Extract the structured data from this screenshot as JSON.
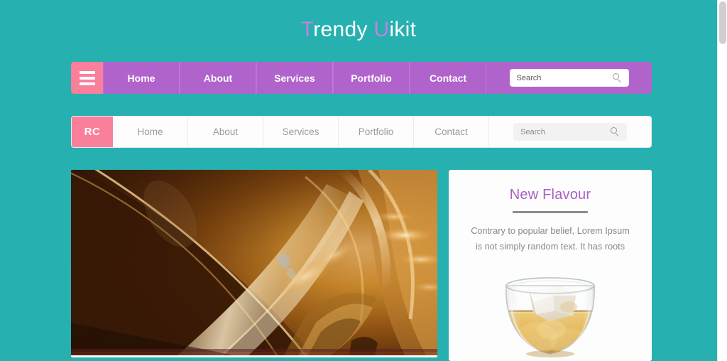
{
  "site": {
    "title_accent_1": "T",
    "title_part_1": "rendy ",
    "title_accent_2": "U",
    "title_part_2": "ikit"
  },
  "navbar_purple": {
    "brand_icon": "hamburger-menu-icon",
    "items": [
      {
        "label": "Home"
      },
      {
        "label": "About"
      },
      {
        "label": "Services"
      },
      {
        "label": "Portfolio"
      },
      {
        "label": "Contact"
      }
    ],
    "search": {
      "placeholder": "Search",
      "value": "",
      "icon": "search-icon"
    },
    "colors": {
      "bar": "#b163cc",
      "brand": "#fa7f9b",
      "text": "#ffffff"
    }
  },
  "navbar_white": {
    "brand_label": "RC",
    "items": [
      {
        "label": "Home"
      },
      {
        "label": "About"
      },
      {
        "label": "Services"
      },
      {
        "label": "Portfolio"
      },
      {
        "label": "Contact"
      }
    ],
    "search": {
      "placeholder": "Search",
      "value": "",
      "icon": "search-icon"
    },
    "colors": {
      "bar": "#fdfdfd",
      "brand": "#fa7f9b",
      "text": "#9b9b9b"
    }
  },
  "hero": {
    "alt": "close-up of golden amber liquid in a glass"
  },
  "flavour_card": {
    "title": "New Flavour",
    "body": "Contrary to popular belief, Lorem Ipsum is not simply random text. It has roots",
    "image_alt": "whiskey glass with ice cubes",
    "title_color": "#a95fc2"
  },
  "theme": {
    "background": "#26b0b0",
    "accent_purple": "#bf84de",
    "accent_pink": "#fa7f9b"
  }
}
